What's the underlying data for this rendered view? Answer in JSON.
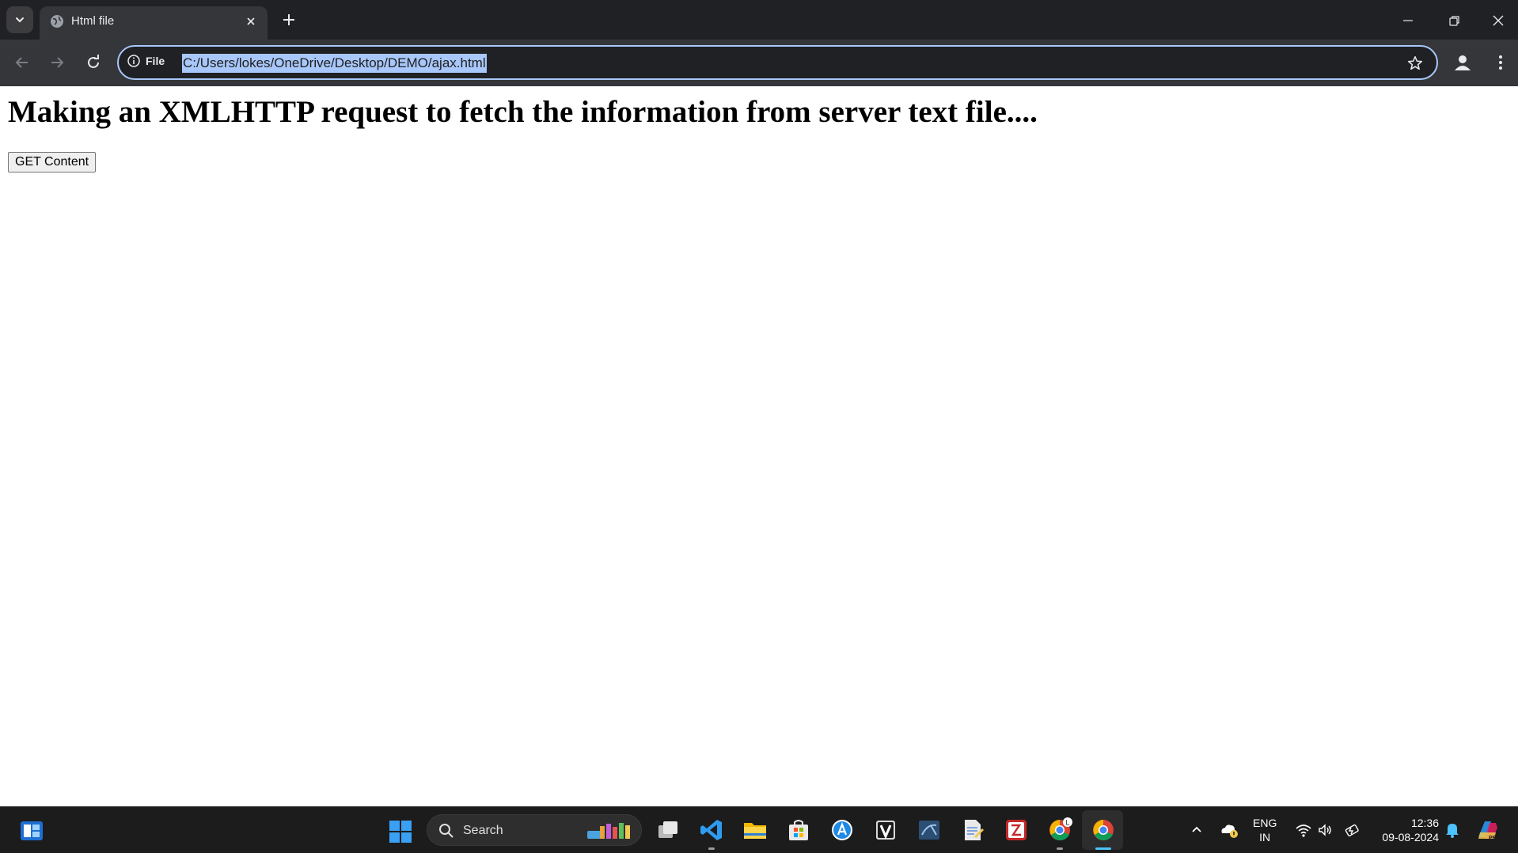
{
  "browser": {
    "tab": {
      "title": "Html file"
    },
    "site_info_label": "File",
    "url": "C:/Users/lokes/OneDrive/Desktop/DEMO/ajax.html",
    "accent": "#a8c7fa"
  },
  "page": {
    "heading": "Making an XMLHTTP request to fetch the information from server text file....",
    "button_label": "GET Content"
  },
  "taskbar": {
    "search_label": "Search",
    "apps": [
      "start-icon",
      "task-view-icon",
      "vscode-icon",
      "file-explorer-icon",
      "ms-store-icon",
      "app-store-icon",
      "vim-icon",
      "mysql-workbench-icon",
      "notepad-icon",
      "filezilla-icon",
      "chrome-profile-icon",
      "chrome-icon"
    ],
    "language_line1": "ENG",
    "language_line2": "IN",
    "time": "12:36",
    "date": "09-08-2024"
  }
}
